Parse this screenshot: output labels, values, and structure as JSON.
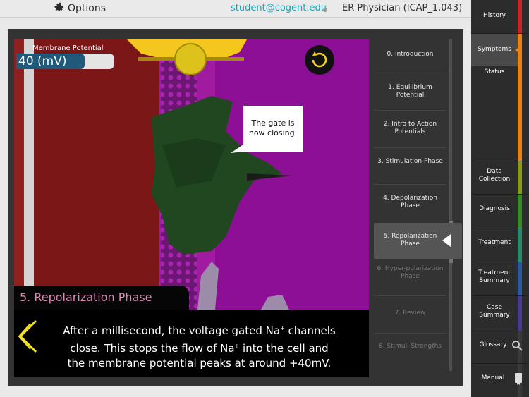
{
  "topbar": {
    "options_label": "Options",
    "user_email": "student@cogent.edu",
    "app_title": "ER Physician (ICAP_1.043)"
  },
  "membrane": {
    "label": "Membrane Potential",
    "value_text": "40 (mV)",
    "level_fraction": 0.7
  },
  "bubble_text": "The gate is now closing.",
  "phase_caption": "5.  Repolarization Phase",
  "narration": {
    "line1a": "After a millisecond, the voltage gated Na",
    "line1sup": "+",
    "line1b": " channels",
    "line2a": "close. This stops the flow of Na",
    "line2sup": "+",
    "line2b": " into the cell and",
    "line3": "the membrane potential peaks at around +40mV."
  },
  "steps": [
    {
      "label": "0.  Introduction",
      "state": "done"
    },
    {
      "label": "1. Equilibrium Potential",
      "state": "done"
    },
    {
      "label": "2. Intro to Action Potentials",
      "state": "done"
    },
    {
      "label": "3. Stimulation Phase",
      "state": "done"
    },
    {
      "label": "4. Depolarization Phase",
      "state": "done"
    },
    {
      "label": "5. Repolarization Phase",
      "state": "active"
    },
    {
      "label": "6. Hyper-polarization Phase",
      "state": "locked"
    },
    {
      "label": "7. Review",
      "state": "locked"
    },
    {
      "label": "8. Stimuli Strengths",
      "state": "locked"
    }
  ],
  "nav": {
    "history": "History",
    "symptoms": "Symptoms",
    "status": "Status",
    "data_collection": "Data Collection",
    "diagnosis": "Diagnosis",
    "treatment": "Treatment",
    "treatment_summary": "Treatment Summary",
    "case_summary": "Case Summary",
    "glossary": "Glossary",
    "manual": "Manual"
  },
  "colors": {
    "accent_teal": "#18a6b7",
    "caption_pink": "#d98ab3",
    "chevron_yellow": "#f3e21c",
    "nav_active_arrow": "#e8821a"
  },
  "icons": [
    "gear-icon",
    "replay-icon",
    "chevron-left-icon",
    "search-icon",
    "manual-icon"
  ]
}
